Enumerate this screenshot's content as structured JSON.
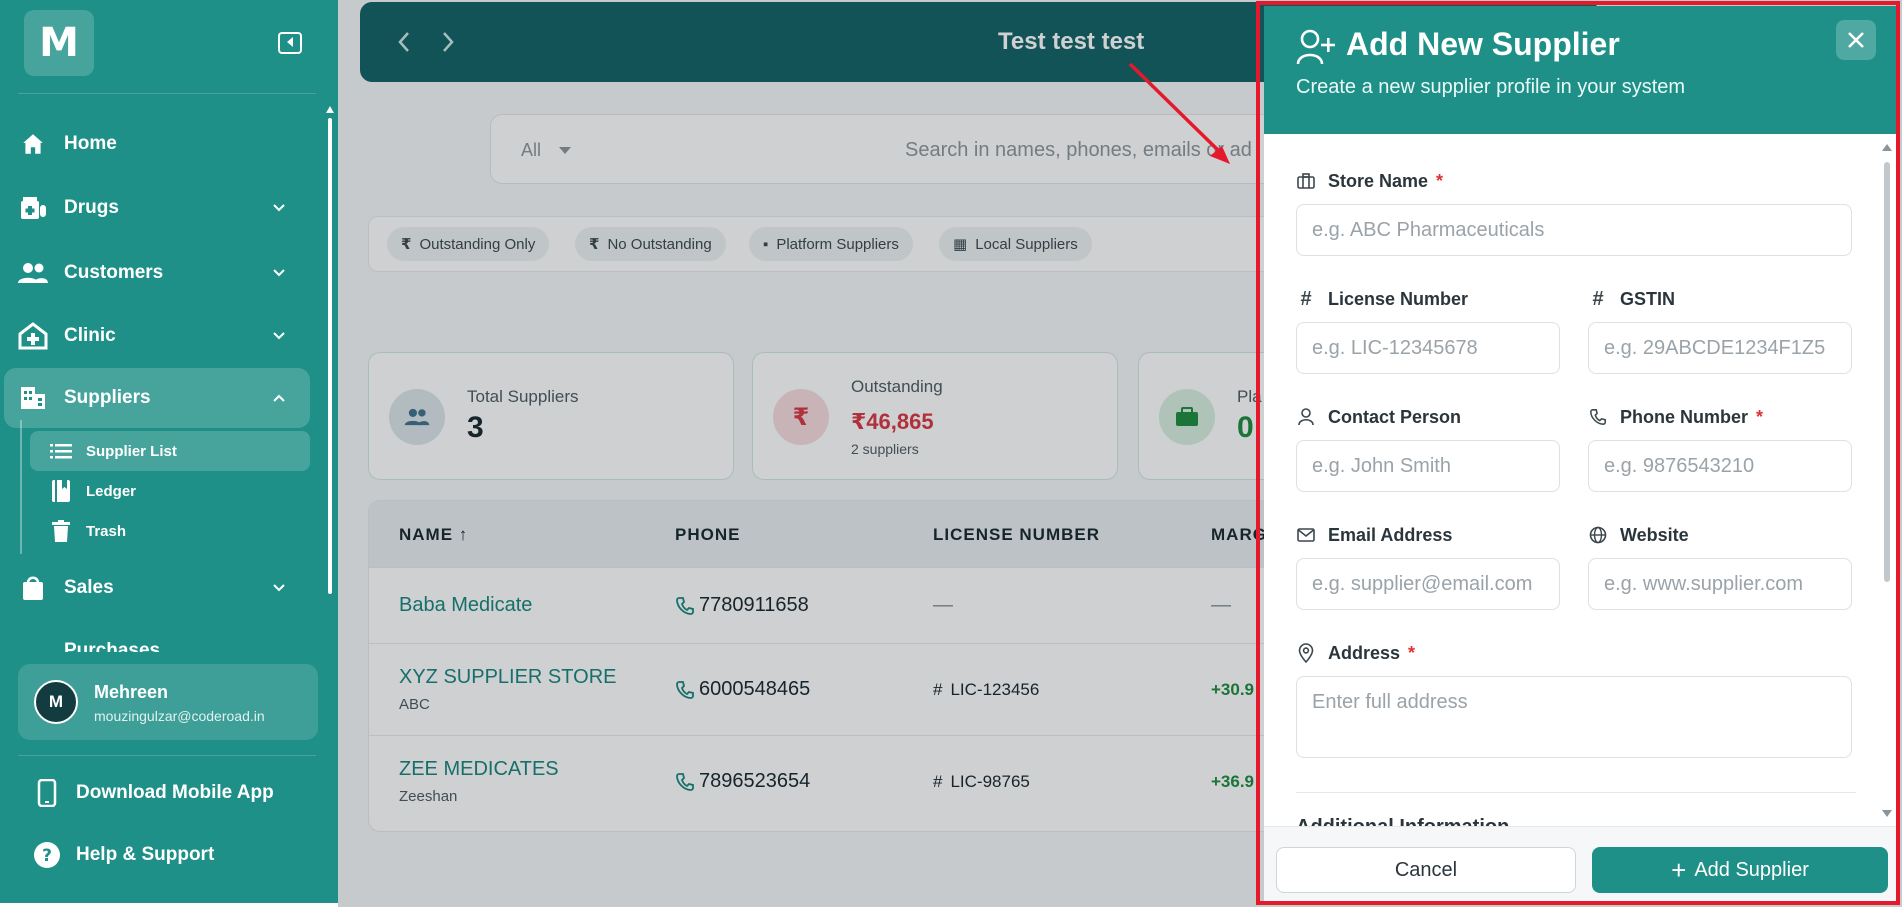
{
  "app": {
    "logo_letter": "M",
    "page_title": "Test test test"
  },
  "sidebar": {
    "items": [
      {
        "label": "Home",
        "icon": "home-icon"
      },
      {
        "label": "Drugs",
        "icon": "pill-bottle-icon"
      },
      {
        "label": "Customers",
        "icon": "users-icon"
      },
      {
        "label": "Clinic",
        "icon": "hospital-icon"
      },
      {
        "label": "Suppliers",
        "icon": "building-icon",
        "expanded": true
      },
      {
        "label": "Sales",
        "icon": "shopping-bag-icon"
      },
      {
        "label": "Purchases",
        "icon": "cart-icon"
      }
    ],
    "sub_items": [
      {
        "label": "Supplier List",
        "icon": "list-icon",
        "active": true
      },
      {
        "label": "Ledger",
        "icon": "book-icon"
      },
      {
        "label": "Trash",
        "icon": "trash-icon"
      }
    ],
    "user": {
      "initial": "M",
      "name": "Mehreen",
      "email": "mouzingulzar@coderoad.in"
    },
    "bottom_links": [
      {
        "label": "Download Mobile App",
        "icon": "smartphone-icon"
      },
      {
        "label": "Help & Support",
        "icon": "help-circle-icon"
      }
    ]
  },
  "search": {
    "filter": "All",
    "placeholder": "Search in names, phones, emails or ad"
  },
  "filters": [
    {
      "label": "Outstanding Only",
      "icon": "rupee-icon"
    },
    {
      "label": "No Outstanding",
      "icon": "rupee-icon"
    },
    {
      "label": "Platform Suppliers",
      "icon": "briefcase-icon"
    },
    {
      "label": "Local Suppliers",
      "icon": "building-icon"
    }
  ],
  "stats": [
    {
      "label": "Total Suppliers",
      "value": "3",
      "sub": ""
    },
    {
      "label": "Outstanding",
      "value": "₹46,865",
      "sub": "2 suppliers"
    },
    {
      "label": "Pla",
      "value": "0",
      "sub": ""
    }
  ],
  "table": {
    "headers": [
      "NAME ↑",
      "PHONE",
      "LICENSE NUMBER",
      "MARG"
    ],
    "rows": [
      {
        "name": "Baba Medicate",
        "sub": "",
        "phone": "7780911658",
        "license": "—",
        "margin": "—"
      },
      {
        "name": "XYZ SUPPLIER STORE",
        "sub": "ABC",
        "phone": "6000548465",
        "license": "LIC-123456",
        "margin": "+30.9"
      },
      {
        "name": "ZEE MEDICATES",
        "sub": "Zeeshan",
        "phone": "7896523654",
        "license": "LIC-98765",
        "margin": "+36.9"
      }
    ]
  },
  "drawer": {
    "title": "Add New Supplier",
    "subtitle": "Create a new supplier profile in your system",
    "fields": {
      "store_name": {
        "label": "Store Name",
        "required": "*",
        "placeholder": "e.g. ABC Pharmaceuticals"
      },
      "license": {
        "label": "License Number",
        "placeholder": "e.g. LIC-12345678"
      },
      "gstin": {
        "label": "GSTIN",
        "placeholder": "e.g. 29ABCDE1234F1Z5"
      },
      "contact": {
        "label": "Contact Person",
        "placeholder": "e.g. John Smith"
      },
      "phone": {
        "label": "Phone Number",
        "required": "*",
        "placeholder": "e.g. 9876543210"
      },
      "email": {
        "label": "Email Address",
        "placeholder": "e.g. supplier@email.com"
      },
      "website": {
        "label": "Website",
        "placeholder": "e.g. www.supplier.com"
      },
      "address": {
        "label": "Address",
        "required": "*",
        "placeholder": "Enter full address"
      }
    },
    "section_partial": "Additional Information",
    "cancel_label": "Cancel",
    "submit_label": "Add Supplier"
  },
  "colors": {
    "brand": "#1e9088",
    "annotation": "#e5192c",
    "required": "#e03131",
    "outstanding": "#d9343f",
    "positive": "#1a8a3c"
  }
}
